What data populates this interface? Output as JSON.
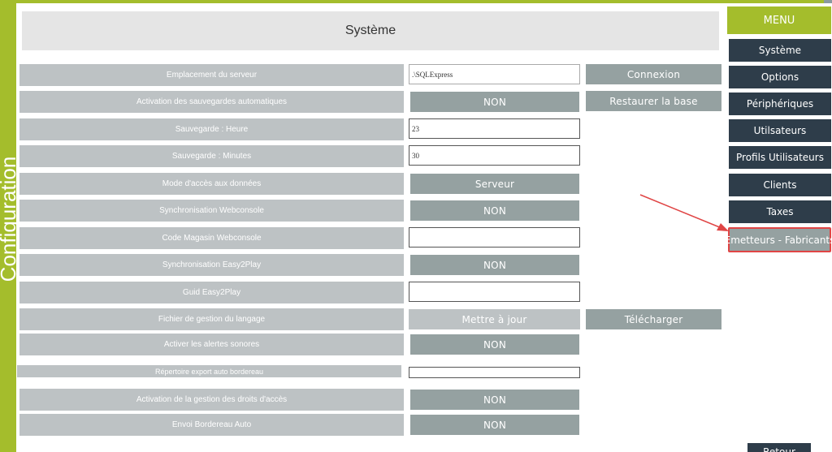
{
  "sidebar": {
    "title": "Configuration"
  },
  "page": {
    "title": "Système"
  },
  "rows": [
    {
      "label": "Emplacement du serveur",
      "value": ".\\SQLExpress",
      "action": "Connexion"
    },
    {
      "label": "Activation des sauvegardes automatiques",
      "value": "NON",
      "action": "Restaurer la base"
    },
    {
      "label": "Sauvegarde : Heure",
      "value": "23"
    },
    {
      "label": "Sauvegarde : Minutes",
      "value": "30"
    },
    {
      "label": "Mode d'accès aux données",
      "value": "Serveur"
    },
    {
      "label": "Synchronisation Webconsole",
      "value": "NON"
    },
    {
      "label": "Code Magasin Webconsole",
      "value": ""
    },
    {
      "label": "Synchronisation Easy2Play",
      "value": "NON"
    },
    {
      "label": "Guid Easy2Play",
      "value": ""
    },
    {
      "label": "Fichier de gestion du langage",
      "value": "Mettre à jour",
      "action": "Télécharger"
    },
    {
      "label": "Activer les alertes sonores",
      "value": "NON"
    },
    {
      "label": "Répertoire export auto bordereau",
      "value": ""
    },
    {
      "label": "Activation de la gestion des droits d'accès",
      "value": "NON"
    },
    {
      "label": "Envoi Bordereau Auto",
      "value": "NON"
    }
  ],
  "menu": {
    "header": "MENU",
    "items": [
      {
        "label": "Système"
      },
      {
        "label": "Options"
      },
      {
        "label": "Périphériques"
      },
      {
        "label": "Utilsateurs"
      },
      {
        "label": "Profils Utilisateurs"
      },
      {
        "label": "Clients"
      },
      {
        "label": "Taxes"
      },
      {
        "label": "Emetteurs - Fabricants"
      }
    ],
    "active_index": 7
  },
  "footer": {
    "button_label": "Retour"
  },
  "colors": {
    "accent_green": "#a4bd2c",
    "menu_dark": "#2e3d4a",
    "button_gray": "#95a1a1",
    "label_gray": "#bdc2c4",
    "annotation_red": "#e04545"
  },
  "icons": {
    "top_right_corner": "close-icon"
  }
}
